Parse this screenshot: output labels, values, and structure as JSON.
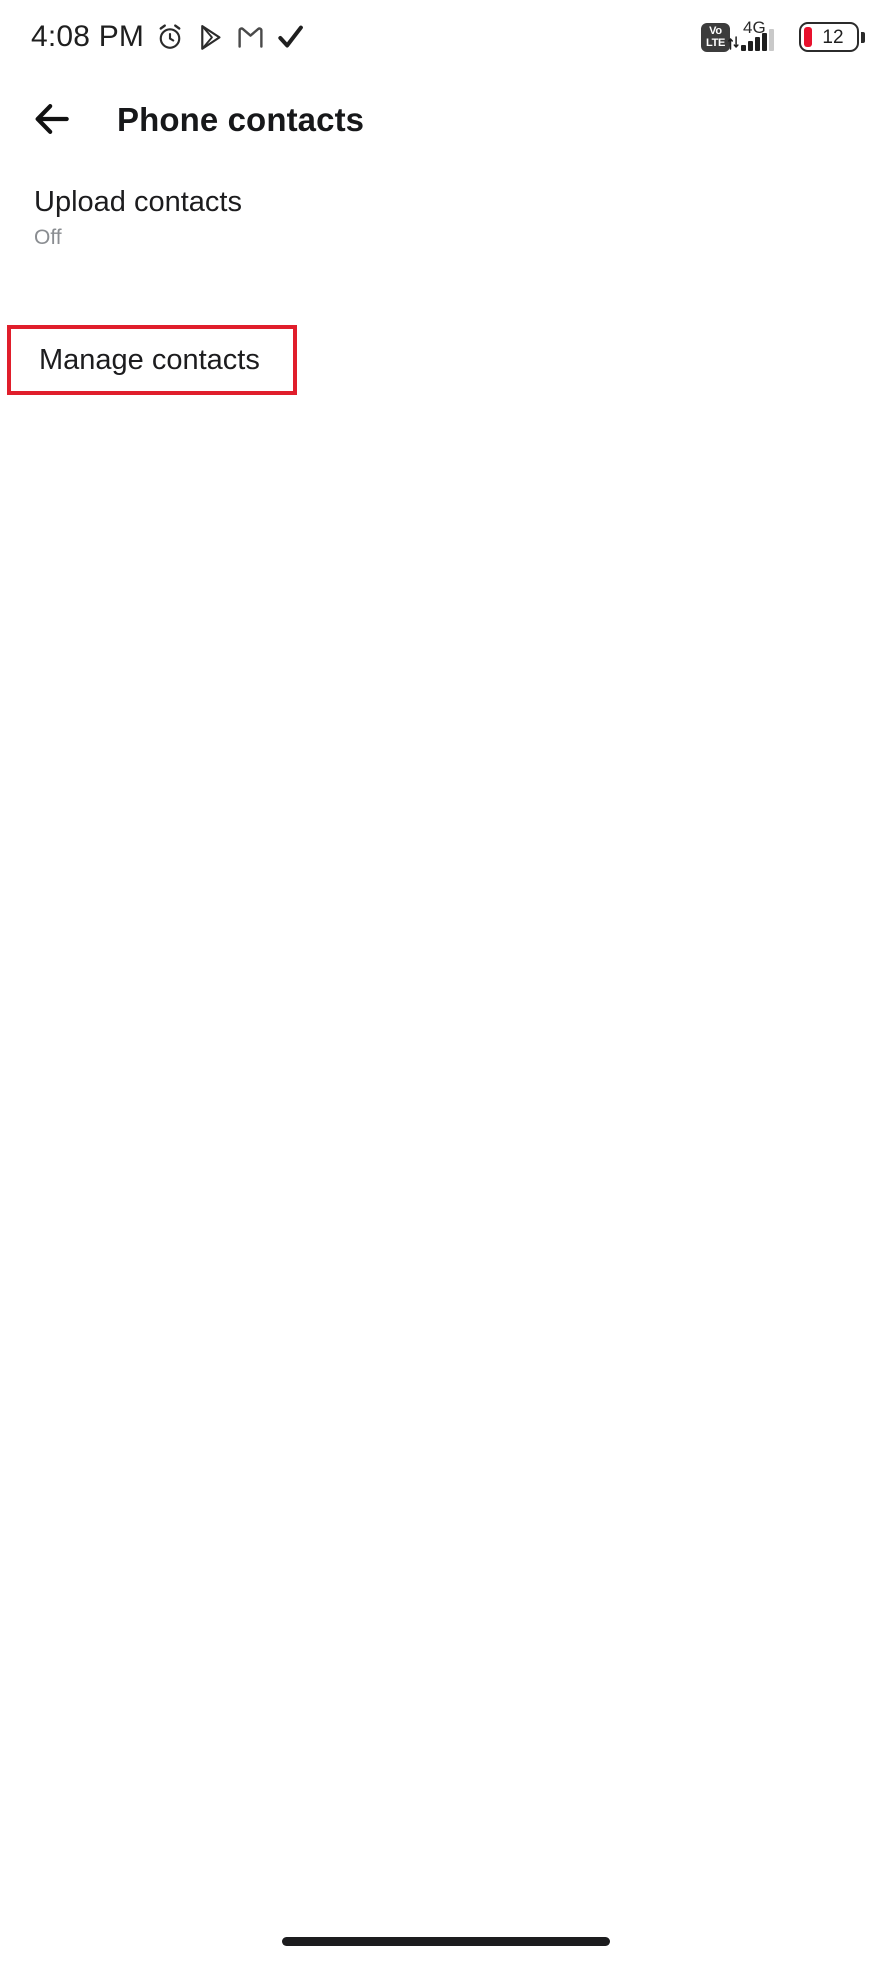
{
  "status_bar": {
    "clock": "4:08 PM",
    "left_icons": [
      {
        "name": "alarm-clock-icon"
      },
      {
        "name": "play-store-icon"
      },
      {
        "name": "gmail-icon"
      },
      {
        "name": "checkmark-icon"
      }
    ],
    "volte_top": "Vo",
    "volte_bottom": "LTE",
    "network_type": "4G",
    "battery_level": "12",
    "battery_color": "#e8112d"
  },
  "app_bar": {
    "back_icon": "back-arrow-icon",
    "title": "Phone contacts"
  },
  "settings": {
    "upload_contacts": {
      "title": "Upload contacts",
      "subtitle": "Off"
    },
    "manage_contacts": {
      "title": "Manage contacts"
    }
  },
  "annotation": {
    "highlight_color": "#e01e2b",
    "highlight_target": "Manage contacts"
  },
  "nav_bar": {
    "gesture_pill": "home-gesture-pill"
  }
}
